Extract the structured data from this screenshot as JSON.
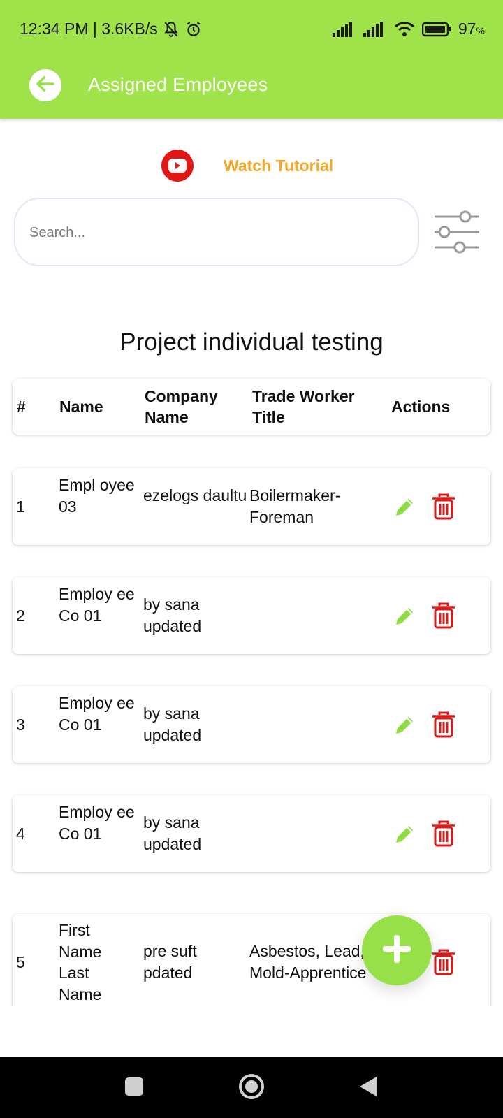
{
  "status_bar": {
    "time_speed": "12:34 PM | 3.6KB/s",
    "battery": "97",
    "battery_unit": "%"
  },
  "app_bar": {
    "title": "Assigned Employees"
  },
  "tutorial": {
    "label": "Watch Tutorial"
  },
  "search": {
    "placeholder": "Search..."
  },
  "project": {
    "title": "Project individual testing"
  },
  "table": {
    "headers": {
      "num": "#",
      "name": "Name",
      "company": "Company Name",
      "trade": "Trade Worker Title",
      "actions": "Actions"
    },
    "rows": [
      {
        "num": "1",
        "name": "Empl oyee 03",
        "company": "ezelogs daultu",
        "trade": "Boilermaker-Foreman"
      },
      {
        "num": "2",
        "name": "Employ ee Co 01",
        "company": "by sana updated",
        "trade": ""
      },
      {
        "num": "3",
        "name": "Employ ee Co 01",
        "company": "by sana updated",
        "trade": ""
      },
      {
        "num": "4",
        "name": "Employ ee Co 01",
        "company": "by sana updated",
        "trade": ""
      },
      {
        "num": "5",
        "name": "First Name Last Name",
        "company": "pre suft pdated",
        "trade": "Asbestos, Lead, Mold-Apprentice"
      }
    ]
  },
  "colors": {
    "primary": "#a0e24a",
    "accent": "#f5a623",
    "danger": "#d81b1b",
    "edit": "#8fdc45",
    "youtube": "#e31616"
  },
  "icons": {
    "back": "arrow-left-icon",
    "tutorial": "youtube-icon",
    "filter": "sliders-icon",
    "edit": "pencil-icon",
    "delete": "trash-icon",
    "fab": "plus-icon"
  }
}
